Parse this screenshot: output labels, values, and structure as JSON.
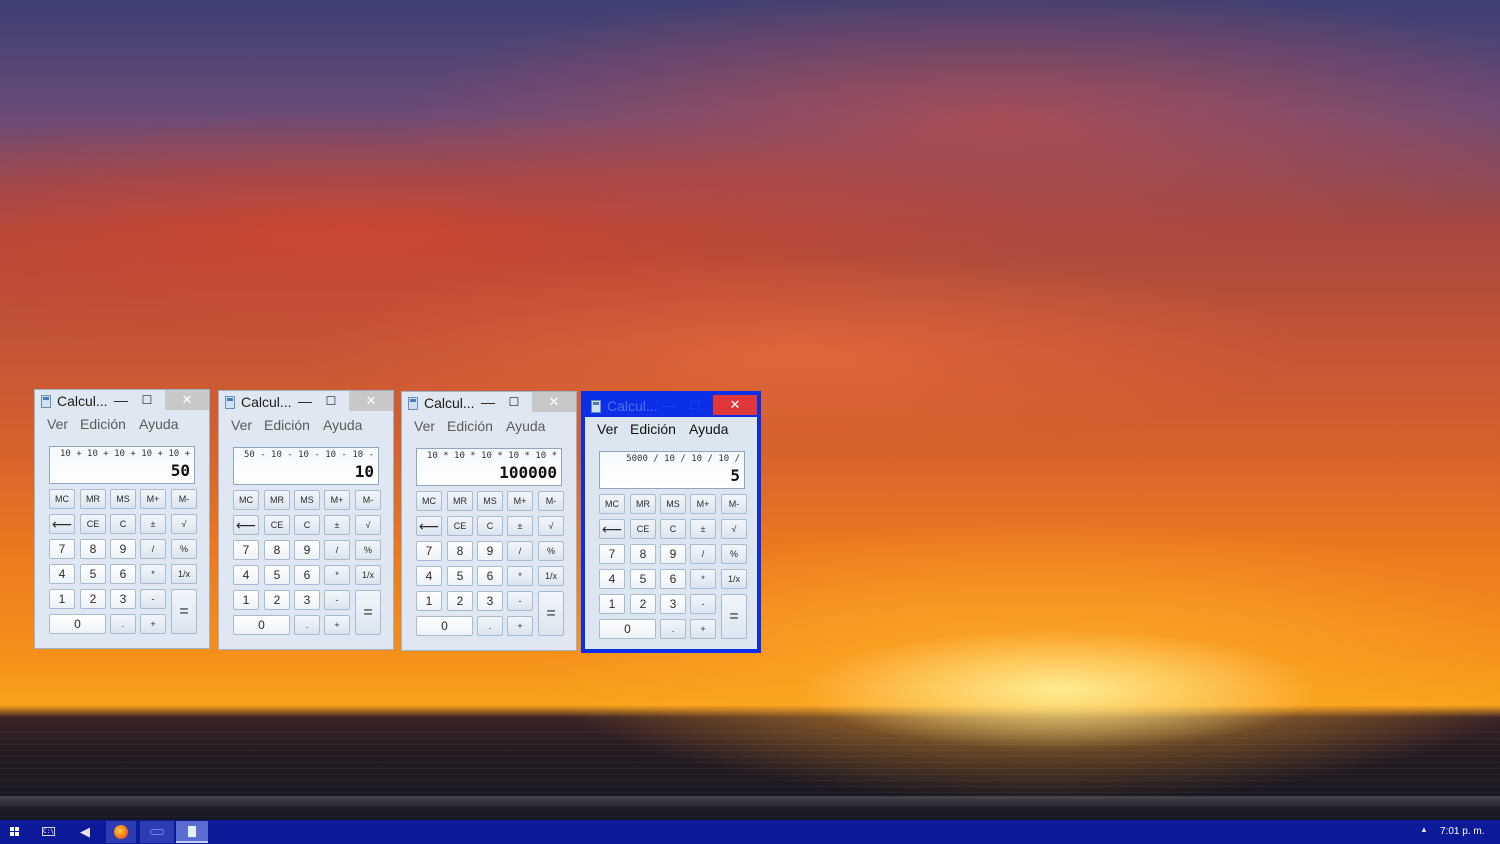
{
  "calculators": [
    {
      "title": "Calcul...",
      "menu": [
        "Ver",
        "Edición",
        "Ayuda"
      ],
      "expression": "10 + 10 + 10 + 10 + 10 +",
      "result": "50",
      "active": false
    },
    {
      "title": "Calcul...",
      "menu": [
        "Ver",
        "Edición",
        "Ayuda"
      ],
      "expression": "50 - 10 - 10 - 10 - 10 -",
      "result": "10",
      "active": false
    },
    {
      "title": "Calcul...",
      "menu": [
        "Ver",
        "Edición",
        "Ayuda"
      ],
      "expression": "10 * 10 * 10 * 10 * 10 *",
      "result": "100000",
      "active": false
    },
    {
      "title": "Calcul...",
      "menu": [
        "Ver",
        "Edición",
        "Ayuda"
      ],
      "expression": "5000 / 10 / 10 / 10 /",
      "result": "5",
      "active": true
    }
  ],
  "window_controls": {
    "minimize": "—",
    "maximize": "☐",
    "close": "✕"
  },
  "keys": {
    "row1": [
      "MC",
      "MR",
      "MS",
      "M+",
      "M-"
    ],
    "row2": [
      "⟵",
      "CE",
      "C",
      "±",
      "√"
    ],
    "row3": [
      "7",
      "8",
      "9",
      "/",
      "%"
    ],
    "row4": [
      "4",
      "5",
      "6",
      "*",
      "1/x"
    ],
    "row5": [
      "1",
      "2",
      "3",
      "-"
    ],
    "row6": [
      "0",
      ".",
      "+"
    ],
    "equals": "="
  },
  "taskbar": {
    "cmd_label": "C:\\",
    "clock": "7:01 p. m.",
    "tray_arrow": "▲",
    "sound_icon": "◀",
    "accent": "#0c1a9a"
  },
  "colors": {
    "active_border": "#0a2fe6",
    "close_active": "#e0383a"
  }
}
